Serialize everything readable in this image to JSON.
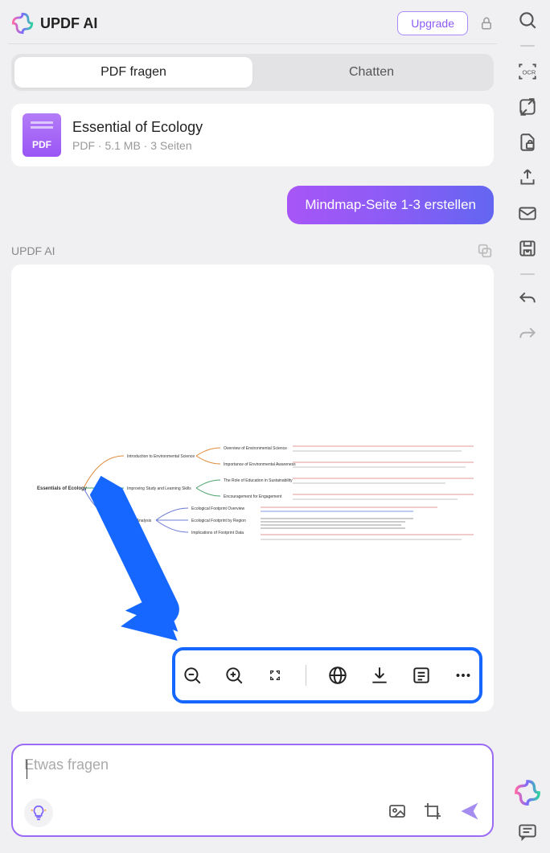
{
  "header": {
    "title": "UPDF AI",
    "upgrade": "Upgrade"
  },
  "tabs": {
    "ask": "PDF fragen",
    "chat": "Chatten"
  },
  "doc": {
    "title": "Essential of Ecology",
    "meta": "PDF · 5.1 MB · 3 Seiten"
  },
  "user_message": "Mindmap-Seite 1-3 erstellen",
  "assistant_label": "UPDF AI",
  "mindmap": {
    "root": "Essentials of Ecology",
    "branches": [
      "Introduction to Environmental Science",
      "Improving Study and Learning Skills",
      "Data Analysis"
    ],
    "subs": [
      "Overview of Environmental Science",
      "Importance of Environmental Awareness",
      "The Role of Education in Sustainability",
      "Encouragement for Engagement",
      "Ecological Footprint Overview",
      "Ecological Footprint by Region",
      "Implications of Footprint Data"
    ]
  },
  "input": {
    "placeholder": "Etwas fragen"
  }
}
